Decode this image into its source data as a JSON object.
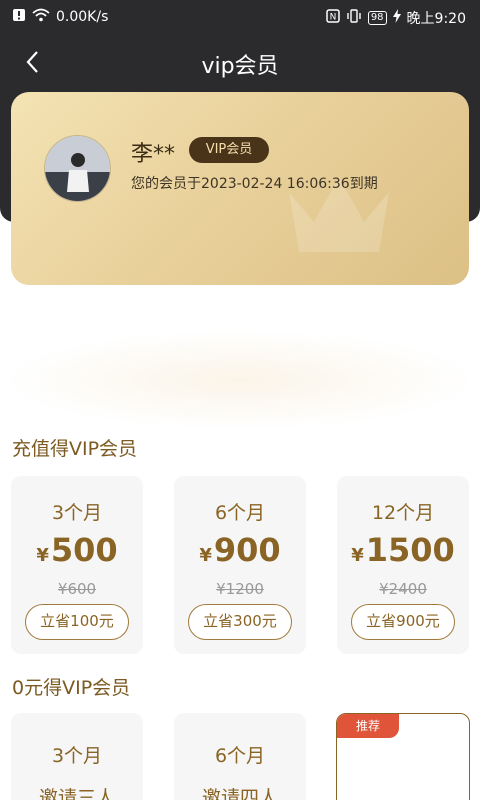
{
  "status_bar": {
    "net_speed": "0.00K/s",
    "battery": "98",
    "time": "晚上9:20"
  },
  "nav": {
    "title": "vip会员"
  },
  "vip_card": {
    "name": "李**",
    "badge": "VIP会员",
    "expire": "您的会员于2023-02-24 16:06:36到期"
  },
  "recharge": {
    "title": "充值得VIP会员",
    "plans": [
      {
        "months": "3个月",
        "currency": "¥",
        "price": "500",
        "original": "¥600",
        "save": "立省100元"
      },
      {
        "months": "6个月",
        "currency": "¥",
        "price": "900",
        "original": "¥1200",
        "save": "立省300元"
      },
      {
        "months": "12个月",
        "currency": "¥",
        "price": "1500",
        "original": "¥2400",
        "save": "立省900元"
      }
    ]
  },
  "free": {
    "title": "0元得VIP会员",
    "plans": [
      {
        "months": "3个月",
        "invite": "邀请三人"
      },
      {
        "months": "6个月",
        "invite": "邀请四人"
      }
    ],
    "tag": "推荐"
  },
  "colors": {
    "header_dark": "#2b2b2d",
    "gold_text": "#8a6425",
    "badge_bg": "#4a3419"
  }
}
